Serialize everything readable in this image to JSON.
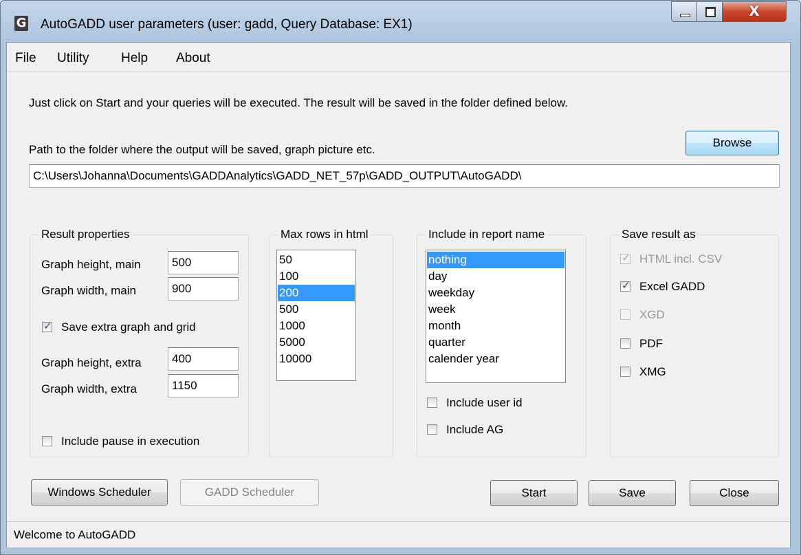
{
  "window": {
    "title": "AutoGADD user parameters (user: gadd, Query Database: EX1)",
    "app_icon_letter": "G",
    "close_glyph": "X"
  },
  "menu": {
    "items": [
      {
        "label": "File"
      },
      {
        "label": "Utility"
      },
      {
        "label": "Help"
      },
      {
        "label": "About"
      }
    ]
  },
  "intro_text": "Just click on Start and your queries will be executed. The result will be saved in the folder defined below.",
  "output": {
    "path_label": "Path to the folder where the output will be saved, graph picture etc.",
    "browse_label": "Browse",
    "path_value": "C:\\Users\\Johanna\\Documents\\GADDAnalytics\\GADD_NET_57p\\GADD_OUTPUT\\AutoGADD\\"
  },
  "result_properties": {
    "title": "Result properties",
    "graph_height_main_label": "Graph height, main",
    "graph_height_main_value": "500",
    "graph_width_main_label": "Graph width, main",
    "graph_width_main_value": "900",
    "save_extra_label": "Save extra graph and grid",
    "save_extra_checked": true,
    "graph_height_extra_label": "Graph height, extra",
    "graph_height_extra_value": "400",
    "graph_width_extra_label": "Graph width, extra",
    "graph_width_extra_value": "1150",
    "include_pause_label": "Include pause in execution",
    "include_pause_checked": false
  },
  "max_rows": {
    "title": "Max rows in html",
    "options": [
      "50",
      "100",
      "200",
      "500",
      "1000",
      "5000",
      "10000"
    ],
    "selected": "200"
  },
  "report_name": {
    "title": "Include in report name",
    "options": [
      "nothing",
      "day",
      "weekday",
      "week",
      "month",
      "quarter",
      "calender year"
    ],
    "selected": "nothing",
    "include_user_id_label": "Include user id",
    "include_ag_label": "Include AG"
  },
  "save_result": {
    "title": "Save result as",
    "options": [
      {
        "label": "HTML incl. CSV",
        "checked": true,
        "enabled": false
      },
      {
        "label": "Excel GADD",
        "checked": true,
        "enabled": true
      },
      {
        "label": "XGD",
        "checked": false,
        "enabled": false
      },
      {
        "label": "PDF",
        "checked": false,
        "enabled": true
      },
      {
        "label": "XMG",
        "checked": false,
        "enabled": true
      }
    ]
  },
  "buttons": {
    "windows_scheduler": "Windows Scheduler",
    "gadd_scheduler": "GADD Scheduler",
    "start": "Start",
    "save": "Save",
    "close": "Close"
  },
  "status": {
    "text": "Welcome to AutoGADD"
  },
  "colors": {
    "selection": "#3399ff",
    "close_button": "#c8452a"
  }
}
